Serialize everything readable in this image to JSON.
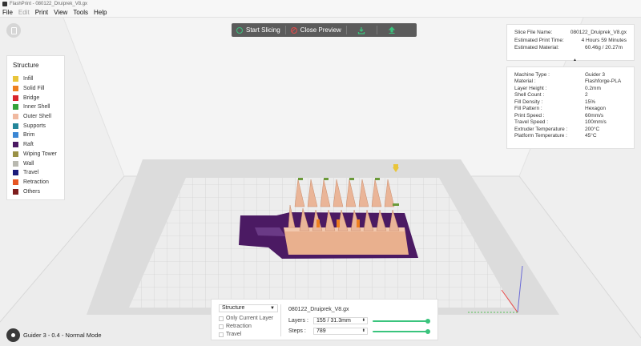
{
  "window": {
    "title": "FlashPrint - 080122_Druiprek_V8.gx"
  },
  "menu": [
    {
      "label": "File",
      "disabled": false
    },
    {
      "label": "Edit",
      "disabled": true
    },
    {
      "label": "Print",
      "disabled": false
    },
    {
      "label": "View",
      "disabled": false
    },
    {
      "label": "Tools",
      "disabled": false
    },
    {
      "label": "Help",
      "disabled": false
    }
  ],
  "toolbar": {
    "start_slicing": "Start Slicing",
    "close_preview": "Close Preview",
    "export_icon": "download-icon",
    "upload_icon": "upload-icon"
  },
  "legend": {
    "title": "Structure",
    "items": [
      {
        "label": "Infill",
        "color": "#e9c53a"
      },
      {
        "label": "Solid Fill",
        "color": "#ee7f1f"
      },
      {
        "label": "Bridge",
        "color": "#d9242a"
      },
      {
        "label": "Inner Shell",
        "color": "#34a33a"
      },
      {
        "label": "Outer Shell",
        "color": "#f0b9a0"
      },
      {
        "label": "Supports",
        "color": "#23869a"
      },
      {
        "label": "Brim",
        "color": "#3b87d4"
      },
      {
        "label": "Raft",
        "color": "#4b1a63"
      },
      {
        "label": "Wiping Tower",
        "color": "#9a9146"
      },
      {
        "label": "Wall",
        "color": "#b9b9b0"
      },
      {
        "label": "Travel",
        "color": "#1b1b7a"
      },
      {
        "label": "Retraction",
        "color": "#e65522"
      },
      {
        "label": "Others",
        "color": "#7d1d1d"
      }
    ]
  },
  "file_info": [
    {
      "label": "Slice File Name:",
      "value": "080122_Druiprek_V8.gx"
    },
    {
      "label": "Estimated Print Time:",
      "value": "4 Hours 59 Minutes"
    },
    {
      "label": "Estimated Material:",
      "value": "60.46g / 20.27m"
    }
  ],
  "print_settings": [
    {
      "label": "Machine Type :",
      "value": "Guider 3"
    },
    {
      "label": "Material :",
      "value": "Flashforge-PLA"
    },
    {
      "label": "Layer Height :",
      "value": "0.2mm"
    },
    {
      "label": "Shell Count :",
      "value": "2"
    },
    {
      "label": "Fill Density :",
      "value": "15%"
    },
    {
      "label": "Fill Pattern :",
      "value": "Hexagon"
    },
    {
      "label": "Print Speed :",
      "value": "60mm/s"
    },
    {
      "label": "Travel Speed :",
      "value": "100mm/s"
    },
    {
      "label": "Extruder Temperature :",
      "value": "200°C"
    },
    {
      "label": "Platform Temperature :",
      "value": "45°C"
    }
  ],
  "bottom_panel": {
    "view_mode": "Structure",
    "options": [
      "Only Current Layer",
      "Retraction",
      "Travel"
    ],
    "filename": "080122_Druiprek_V8.gx",
    "layers_label": "Layers :",
    "layers_value": "155 / 31.3mm",
    "layers_fraction": 1.0,
    "steps_label": "Steps :",
    "steps_value": "789",
    "steps_fraction": 1.0
  },
  "status": {
    "text": "Guider 3 - 0.4 - Normal Mode"
  }
}
